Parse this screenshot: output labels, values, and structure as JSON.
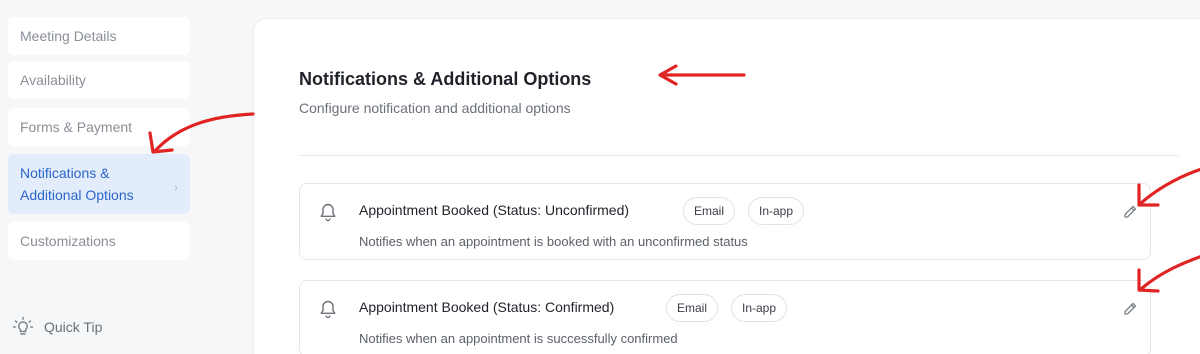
{
  "sidebar": {
    "items": [
      {
        "label": "Meeting Details"
      },
      {
        "label": "Availability"
      },
      {
        "label": "Forms & Payment"
      },
      {
        "label": "Notifications &\nAdditional Options",
        "active": true
      },
      {
        "label": "Customizations"
      }
    ],
    "quick_tip": "Quick Tip",
    "active_color": "#2b66c9"
  },
  "main": {
    "title": "Notifications & Additional Options",
    "subtitle": "Configure notification and additional options",
    "notifications": [
      {
        "name": "Appointment Booked (Status: Unconfirmed)",
        "channels": [
          "Email",
          "In-app"
        ],
        "description": "Notifies when an appointment is booked with an unconfirmed status"
      },
      {
        "name": "Appointment Booked (Status: Confirmed)",
        "channels": [
          "Email",
          "In-app"
        ],
        "description": "Notifies when an appointment is successfully confirmed"
      }
    ]
  },
  "annotations": {
    "arrow_color": "#e02424"
  }
}
